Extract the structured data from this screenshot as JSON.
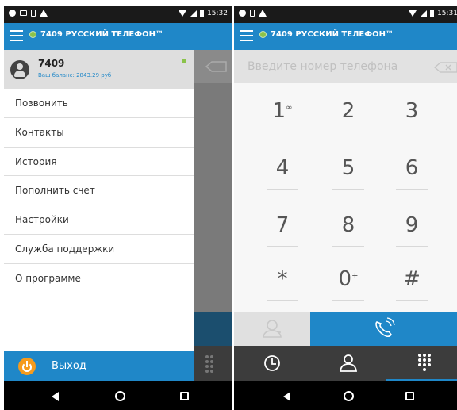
{
  "status_bar": {
    "time_left": "15:32",
    "time_right": "15:31"
  },
  "app": {
    "title": "7409 РУССКИЙ ТЕЛЕФОН™"
  },
  "drawer": {
    "account_name": "7409",
    "balance": "Ваш баланс: 2843.29 руб",
    "menu": [
      "Позвонить",
      "Контакты",
      "История",
      "Пополнить счет",
      "Настройки",
      "Служба поддержки",
      "О программе"
    ],
    "logout_label": "Выход"
  },
  "dialer": {
    "placeholder": "Введите номер телефона",
    "keys": [
      {
        "digit": "1",
        "sub": "∞"
      },
      {
        "digit": "2",
        "sub": ""
      },
      {
        "digit": "3",
        "sub": ""
      },
      {
        "digit": "4",
        "sub": ""
      },
      {
        "digit": "5",
        "sub": ""
      },
      {
        "digit": "6",
        "sub": ""
      },
      {
        "digit": "7",
        "sub": ""
      },
      {
        "digit": "8",
        "sub": ""
      },
      {
        "digit": "9",
        "sub": ""
      },
      {
        "digit": "*",
        "sub": ""
      },
      {
        "digit": "0",
        "sub": "+"
      },
      {
        "digit": "#",
        "sub": ""
      }
    ]
  },
  "tabs": [
    {
      "icon": "clock-icon"
    },
    {
      "icon": "person-icon"
    },
    {
      "icon": "dialpad-icon"
    }
  ],
  "colors": {
    "accent": "#1f87c8",
    "online": "#8bc34a",
    "logout_icon": "#f59b1d"
  }
}
